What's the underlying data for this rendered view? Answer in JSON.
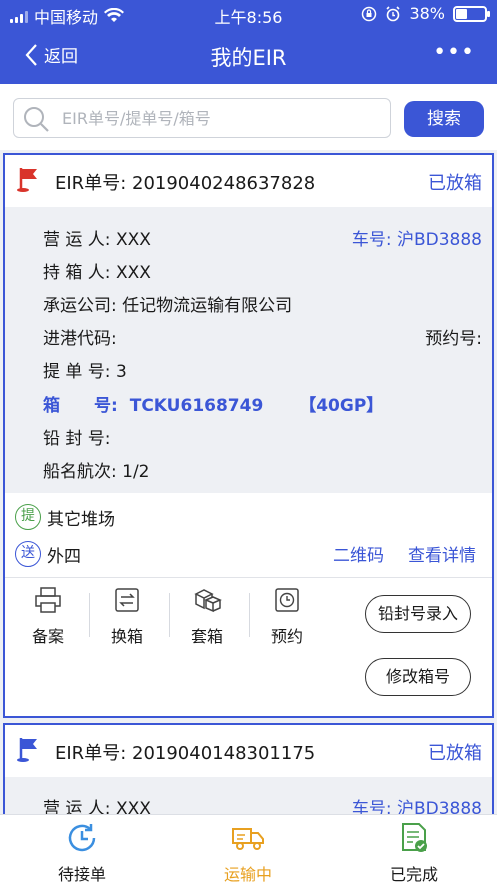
{
  "status_bar": {
    "carrier": "中国移动",
    "time": "上午8:56",
    "battery": "38%",
    "battery_level": 0.38
  },
  "nav": {
    "back": "返回",
    "title": "我的EIR",
    "more": "•••"
  },
  "search": {
    "placeholder": "EIR单号/提单号/箱号",
    "value": "",
    "button": "搜索"
  },
  "cards": [
    {
      "eir_label": "EIR单号:",
      "eir_no": "2019040248637828",
      "status": "已放箱",
      "operator": "营 运 人: XXX",
      "plate": "车号: 沪BD3888",
      "holder": "持 箱 人: XXX",
      "carrier_co": "承运公司: 任记物流运输有限公司",
      "port_code": "进港代码:",
      "booking_no": "预约号:",
      "bl_no": "提 单 号: 3",
      "box_label": "箱　　号:",
      "box_no": "TCKU6168749",
      "box_type": "【40GP】",
      "seal_no": "铅 封 号:",
      "voyage": "船名航次: 1/2",
      "pickup_badge": "提",
      "pickup_site": "其它堆场",
      "drop_badge": "送",
      "drop_site": "外四",
      "qr_link": "二维码",
      "detail_link": "查看详情",
      "actions": [
        "备案",
        "换箱",
        "套箱",
        "预约"
      ],
      "seal_entry": "铅封号录入",
      "edit_box": "修改箱号"
    },
    {
      "eir_label": "EIR单号:",
      "eir_no": "2019040148301175",
      "status": "已放箱",
      "operator": "营 运 人: XXX",
      "plate": "车号: 沪BD3888"
    }
  ],
  "tabs": [
    {
      "label": "待接单"
    },
    {
      "label": "运输中"
    },
    {
      "label": "已完成"
    }
  ],
  "colors": {
    "primary": "#3b56d6",
    "active_tab": "#e8a020",
    "green": "#4aa04a",
    "flag_red": "#d9342b"
  }
}
